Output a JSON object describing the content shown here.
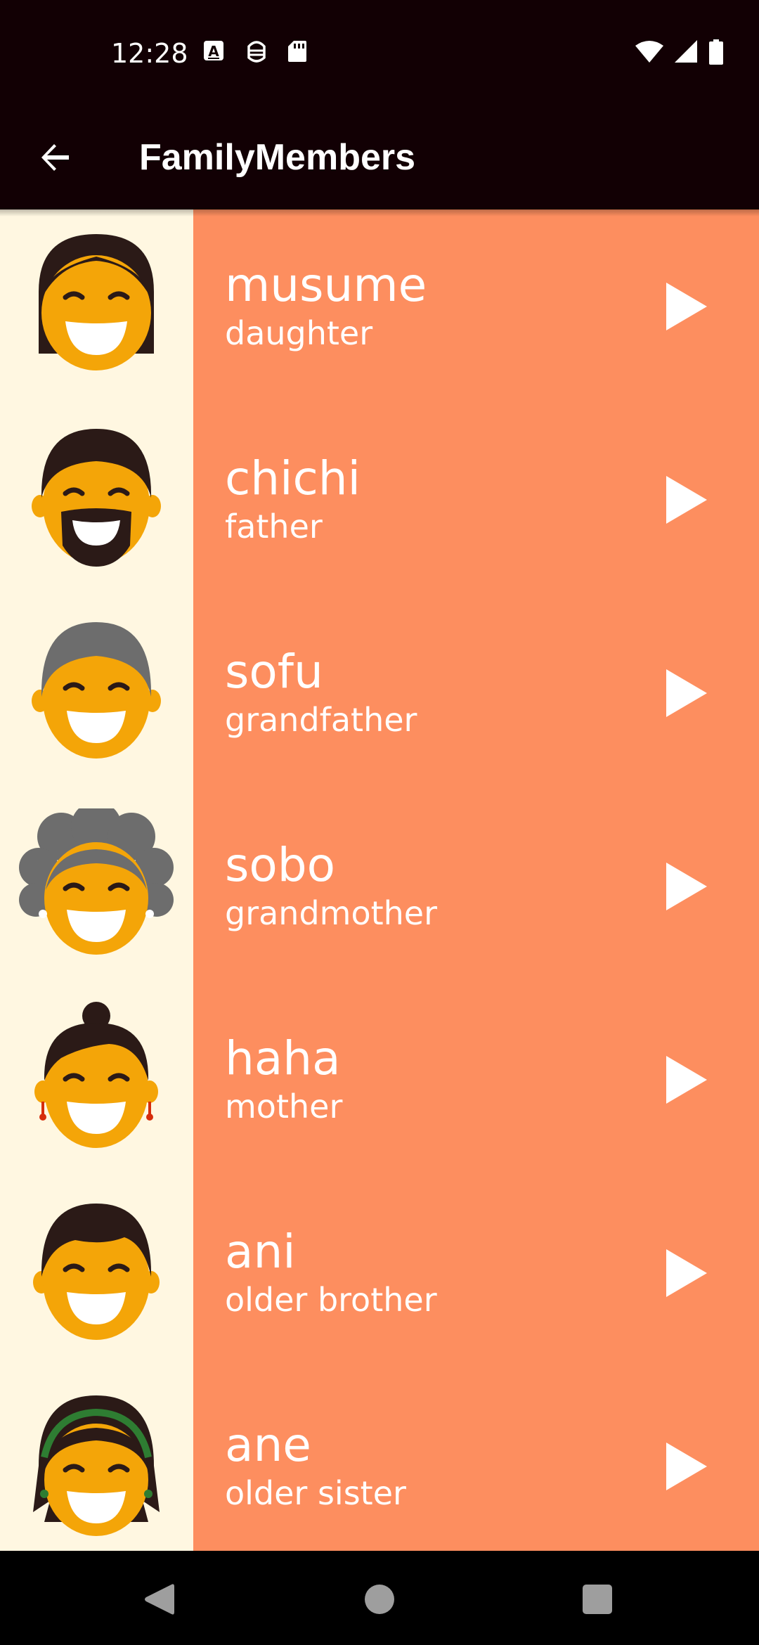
{
  "status_bar": {
    "time": "12:28",
    "icons_left": [
      "keyboard-a-icon",
      "android-debug-icon",
      "sd-card-icon"
    ],
    "icons_right": [
      "wifi-icon",
      "cell-signal-icon",
      "battery-icon"
    ]
  },
  "app_bar": {
    "back_icon": "arrow-back-icon",
    "title": "FamilyMembers"
  },
  "members": [
    {
      "word": "musume",
      "translation": "daughter",
      "avatar": "daughter-avatar",
      "hair": "#2B1A17"
    },
    {
      "word": "chichi",
      "translation": "father",
      "avatar": "father-avatar",
      "hair": "#2B1A17"
    },
    {
      "word": "sofu",
      "translation": "grandfather",
      "avatar": "grandfather-avatar",
      "hair": "#6D6D6D"
    },
    {
      "word": "sobo",
      "translation": "grandmother",
      "avatar": "grandmother-avatar",
      "hair": "#6D6D6D"
    },
    {
      "word": "haha",
      "translation": "mother",
      "avatar": "mother-avatar",
      "hair": "#2B1A17"
    },
    {
      "word": "ani",
      "translation": "older brother",
      "avatar": "older-brother-avatar",
      "hair": "#2B1A17"
    },
    {
      "word": "ane",
      "translation": "older sister",
      "avatar": "older-sister-avatar",
      "hair": "#2B1A17"
    }
  ],
  "play_icon": "play-icon",
  "nav_bar": {
    "back": "nav-back-icon",
    "home": "nav-home-icon",
    "recents": "nav-recents-icon"
  },
  "colors": {
    "app_bar_bg": "#120004",
    "avatar_bg": "#FFF7E1",
    "row_bg": "#FD8E5F",
    "skin": "#F4A508",
    "text": "#FFFFFF"
  }
}
